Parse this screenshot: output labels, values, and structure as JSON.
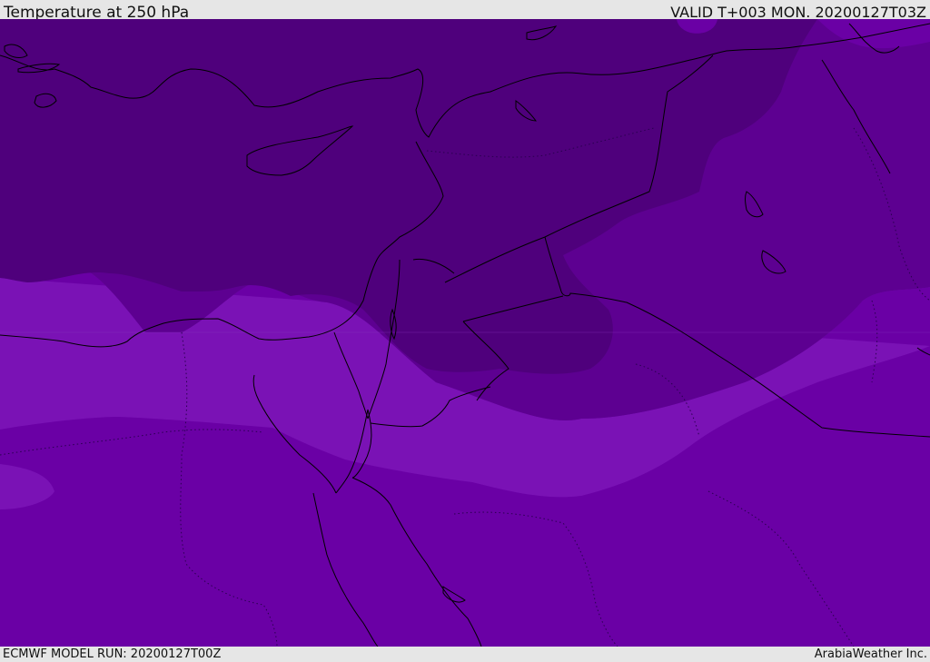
{
  "header": {
    "title": "Temperature at 250 hPa",
    "valid": "VALID T+003 MON. 20200127T03Z"
  },
  "footer": {
    "model_run": "ECMWF MODEL RUN: 20200127T00Z",
    "credit": "ArabiaWeather Inc."
  },
  "colors": {
    "band_darkest": "#4f007c",
    "band_dark": "#5d0091",
    "band_mid": "#6a00a5",
    "band_light": "#7a12b5",
    "band_bright": "#7d00ff",
    "coastline": "#000000",
    "border": "#1a0033"
  }
}
